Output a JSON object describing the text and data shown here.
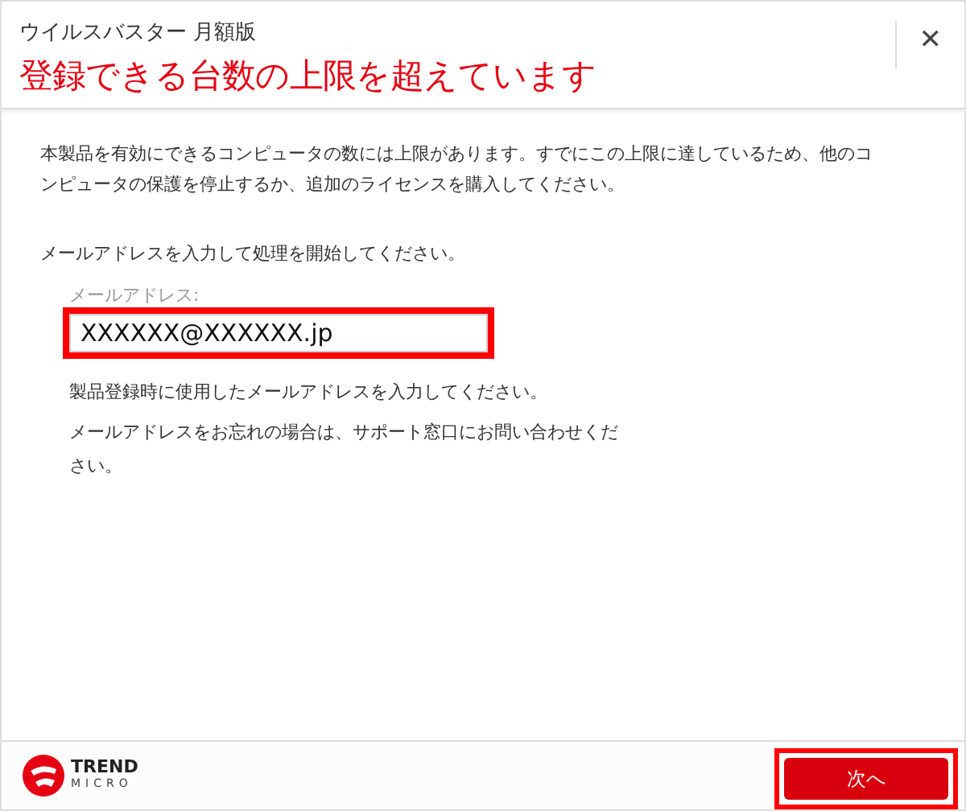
{
  "window": {
    "app_name": "ウイルスバスター 月額版",
    "title": "登録できる台数の上限を超えています",
    "close": "✕"
  },
  "body": {
    "intro": "本製品を有効にできるコンピュータの数には上限があります。すでにこの上限に達しているため、他のコンピュータの保護を停止するか、追加のライセンスを購入してください。",
    "prompt": "メールアドレスを入力して処理を開始してください。",
    "email_field": {
      "label": "メールアドレス:",
      "value": "XXXXXX@XXXXXX.jp",
      "highlighted": true
    },
    "help": [
      "製品登録時に使用したメールアドレスを入力してください。",
      "メールアドレスをお忘れの場合は、サポート窓口にお問い合わせください。"
    ]
  },
  "footer": {
    "logo": {
      "line_1": "TREND",
      "line_2": "MICRO"
    },
    "next_button": {
      "label": "次へ",
      "highlighted": true
    }
  }
}
